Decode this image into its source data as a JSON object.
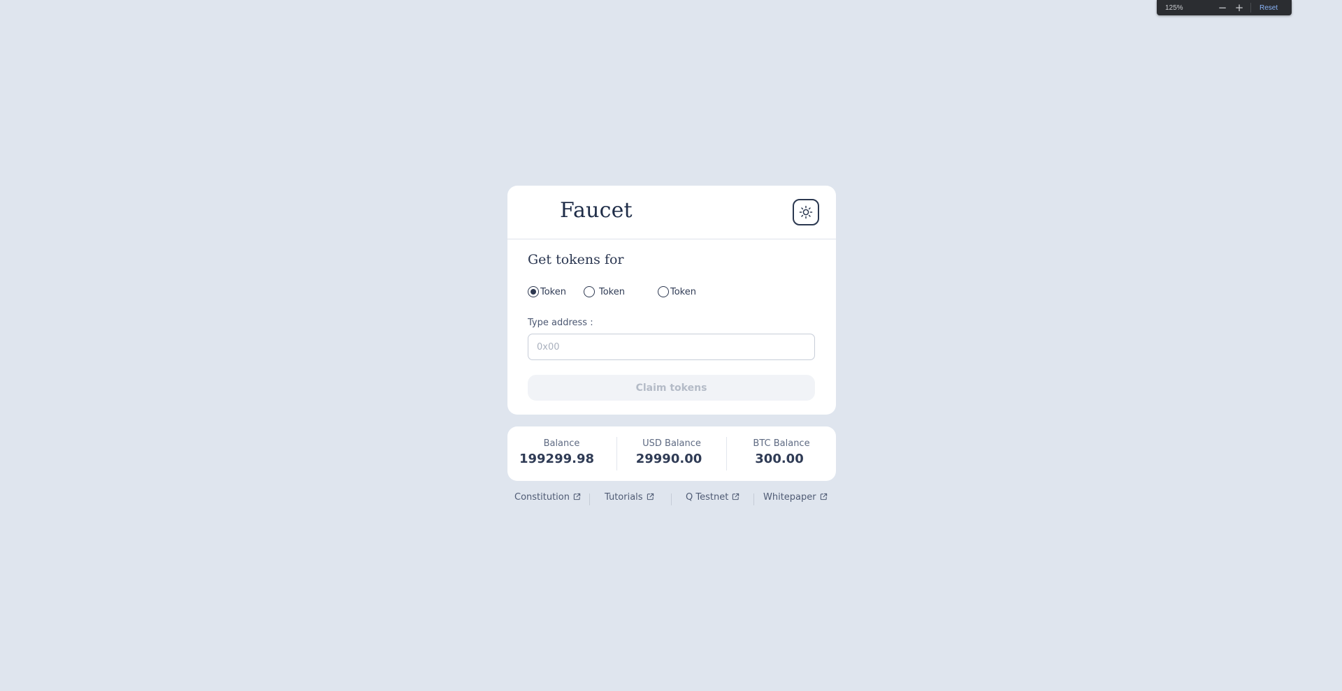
{
  "zoom": {
    "level": "125%",
    "minus": "−",
    "plus": "+",
    "reset": "Reset"
  },
  "header": {
    "title": "Faucet",
    "theme_icon": "sun-icon"
  },
  "form": {
    "section_title": "Get tokens for",
    "radio_options": [
      {
        "label": "Token",
        "selected": true
      },
      {
        "label": "Token",
        "selected": false
      },
      {
        "label": "Token",
        "selected": false
      }
    ],
    "address_label": "Type address :",
    "address_placeholder": "0x00",
    "address_value": "",
    "claim_label": "Claim tokens"
  },
  "balances": [
    {
      "label": "Balance",
      "value": "199299.98"
    },
    {
      "label": "USD Balance",
      "value": "29990.00"
    },
    {
      "label": "BTC Balance",
      "value": "300.00"
    }
  ],
  "footer": {
    "links": [
      {
        "label": "Constitution",
        "icon": "external-link-icon"
      },
      {
        "label": "Tutorials",
        "icon": "external-link-icon"
      },
      {
        "label": "Q Testnet",
        "icon": "external-link-icon"
      },
      {
        "label": "Whitepaper",
        "icon": "external-link-icon"
      }
    ]
  },
  "colors": {
    "background": "#dfe5ee",
    "card": "#ffffff",
    "text_dark": "#1f2d48"
  }
}
